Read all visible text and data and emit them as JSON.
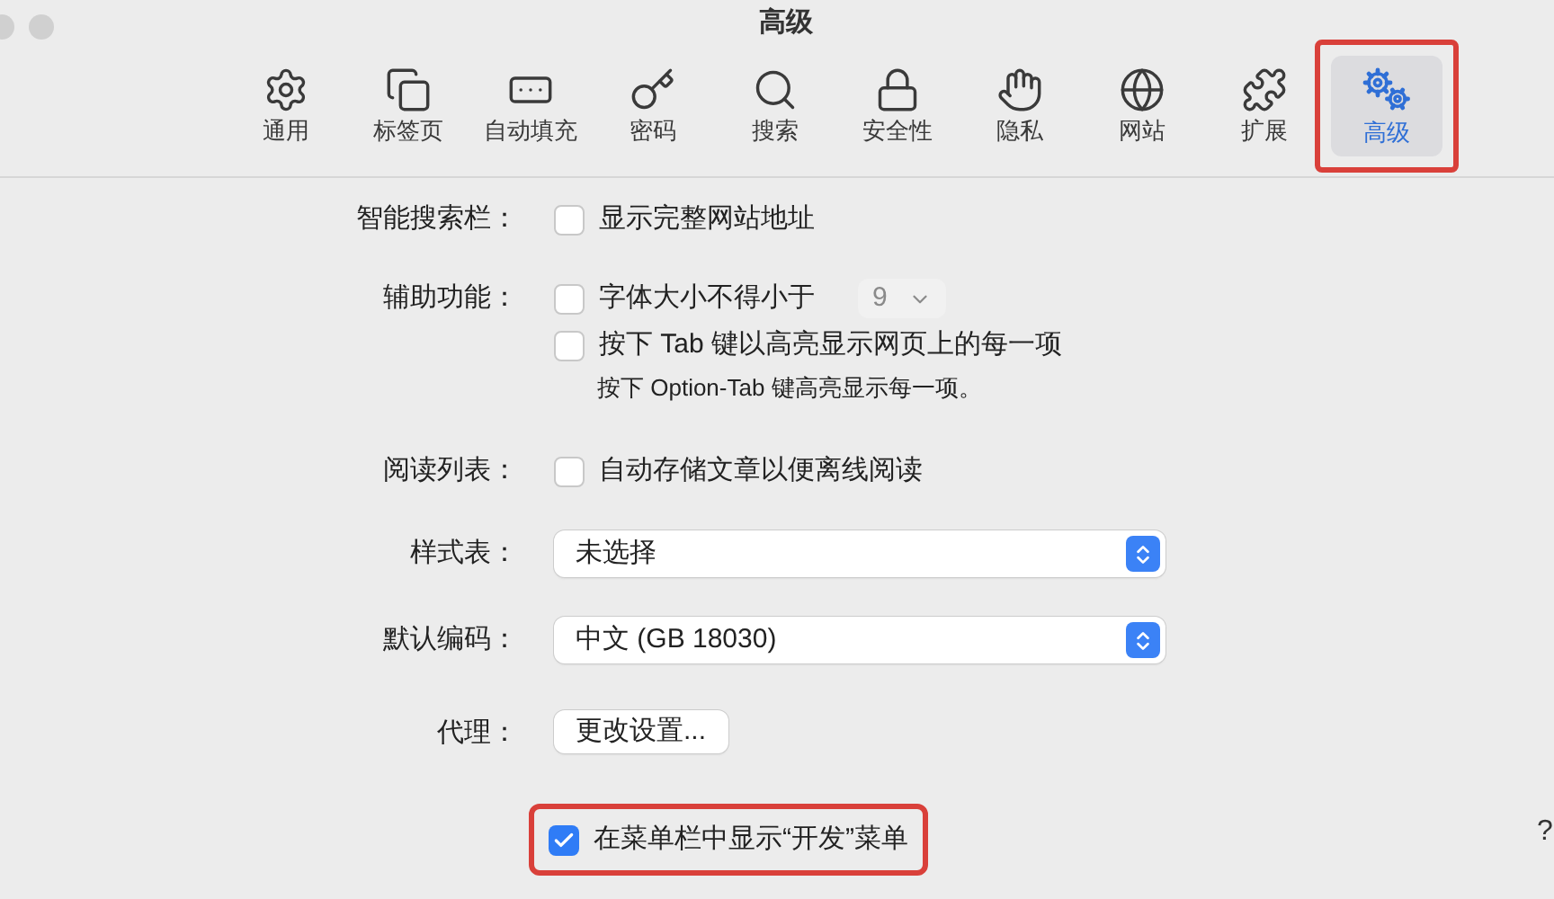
{
  "window": {
    "title": "高级"
  },
  "tabs": [
    {
      "label": "通用",
      "selected": false,
      "highlighted": false
    },
    {
      "label": "标签页",
      "selected": false,
      "highlighted": false
    },
    {
      "label": "自动填充",
      "selected": false,
      "highlighted": false
    },
    {
      "label": "密码",
      "selected": false,
      "highlighted": false
    },
    {
      "label": "搜索",
      "selected": false,
      "highlighted": false
    },
    {
      "label": "安全性",
      "selected": false,
      "highlighted": false
    },
    {
      "label": "隐私",
      "selected": false,
      "highlighted": false
    },
    {
      "label": "网站",
      "selected": false,
      "highlighted": false
    },
    {
      "label": "扩展",
      "selected": false,
      "highlighted": false
    },
    {
      "label": "高级",
      "selected": true,
      "highlighted": true
    }
  ],
  "settings": [
    {
      "label": "智能搜索栏：",
      "controls": [
        {
          "kind": "checkbox",
          "text": "显示完整网站地址",
          "checked": false,
          "highlighted": false
        }
      ]
    },
    {
      "label": "辅助功能：",
      "controls": [
        {
          "kind": "checkbox",
          "text": "字体大小不得小于",
          "checked": false,
          "highlighted": false,
          "select": {
            "value": "9",
            "disabled": true
          }
        },
        {
          "kind": "checkbox",
          "text": "按下 Tab 键以高亮显示网页上的每一项",
          "checked": false,
          "highlighted": false
        },
        {
          "kind": "hint",
          "text": "按下 Option-Tab 键高亮显示每一项。"
        }
      ]
    },
    {
      "label": "阅读列表：",
      "controls": [
        {
          "kind": "checkbox",
          "text": "自动存储文章以便离线阅读",
          "checked": false,
          "highlighted": false
        }
      ]
    },
    {
      "label": "样式表：",
      "controls": [
        {
          "kind": "select",
          "text": "未选择"
        }
      ]
    },
    {
      "label": "默认编码：",
      "controls": [
        {
          "kind": "select",
          "text": "中文 (GB 18030)"
        }
      ]
    },
    {
      "label": "代理：",
      "controls": [
        {
          "kind": "button",
          "text": "更改设置..."
        }
      ]
    },
    {
      "controls": [
        {
          "kind": "checkbox",
          "text": "在菜单栏中显示“开发”菜单",
          "checked": true,
          "highlighted": true
        }
      ]
    }
  ],
  "help": {
    "text": "?"
  }
}
